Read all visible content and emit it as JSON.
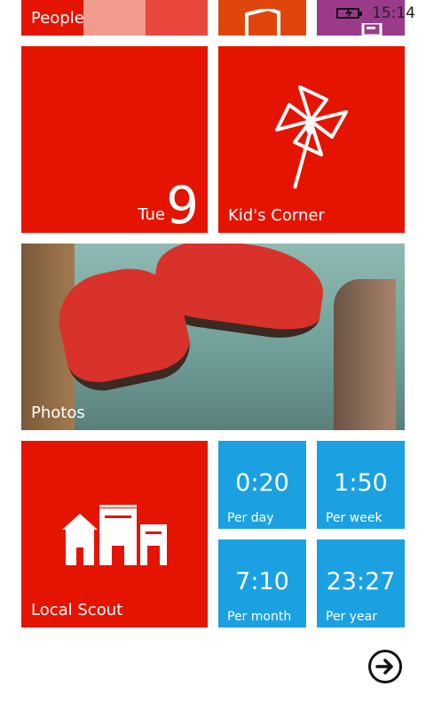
{
  "status_bar": {
    "time": "15:14",
    "battery_icon": "battery-charging-icon"
  },
  "colors": {
    "red": "#e51400",
    "orange": "#e0460b",
    "purple": "#9b3a8b",
    "blue": "#1ba1e2"
  },
  "tiles": {
    "people": {
      "label": "People"
    },
    "office": {
      "icon": "office-icon"
    },
    "purple": {
      "icon": "messaging-icon"
    },
    "calendar": {
      "day": "Tue",
      "date": "9"
    },
    "kids_corner": {
      "label": "Kid's Corner",
      "icon": "pinwheel-icon"
    },
    "photos": {
      "label": "Photos"
    },
    "local_scout": {
      "label": "Local Scout",
      "icon": "buildings-icon"
    },
    "stats": [
      {
        "value": "0:20",
        "label": "Per day"
      },
      {
        "value": "1:50",
        "label": "Per week"
      },
      {
        "value": "7:10",
        "label": "Per month"
      },
      {
        "value": "23:27",
        "label": "Per year"
      }
    ]
  },
  "nav": {
    "all_apps_icon": "arrow-right-circle-icon"
  }
}
